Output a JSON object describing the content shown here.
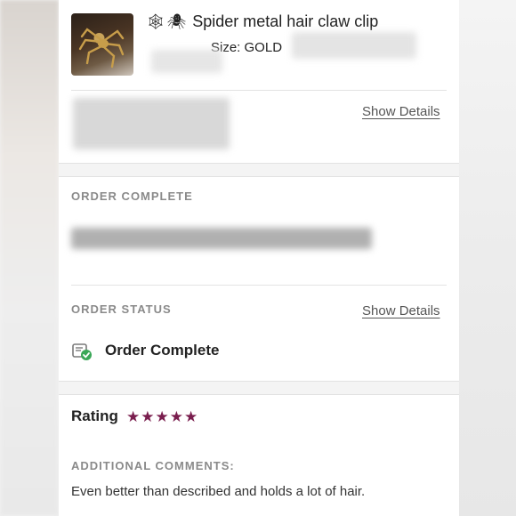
{
  "product": {
    "icons": [
      "spider-web-icon",
      "spider-icon"
    ],
    "web_glyph": "🕸",
    "spider_glyph": "🕷",
    "title": "Spider metal hair claw clip",
    "size_line": "Size: GOLD"
  },
  "links": {
    "show_details_1": "Show Details",
    "show_details_2": "Show Details"
  },
  "order_complete": {
    "label": "ORDER COMPLETE"
  },
  "order_status": {
    "label": "ORDER STATUS",
    "value": "Order Complete",
    "icon": "order-complete-icon",
    "check_color": "#3aa757"
  },
  "rating": {
    "label": "Rating",
    "stars": "★★★★★",
    "value": 5,
    "star_color": "#7a1e4e"
  },
  "comments": {
    "label": "ADDITIONAL COMMENTS:",
    "text": "Even better than described and holds a lot of hair."
  }
}
